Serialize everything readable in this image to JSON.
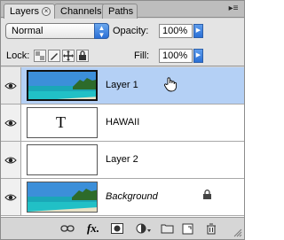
{
  "tabs": [
    {
      "label": "Layers",
      "active": true
    },
    {
      "label": "Channels",
      "active": false
    },
    {
      "label": "Paths",
      "active": false
    }
  ],
  "options": {
    "blend_mode": "Normal",
    "opacity_label": "Opacity:",
    "opacity_value": "100%",
    "lock_label": "Lock:",
    "fill_label": "Fill:",
    "fill_value": "100%"
  },
  "layers": [
    {
      "name": "Layer 1",
      "selected": true,
      "visible": true,
      "thumbnail": "beach-photo"
    },
    {
      "name": "HAWAII",
      "selected": false,
      "visible": true,
      "thumbnail": "type-layer",
      "type_glyph": "T"
    },
    {
      "name": "Layer 2",
      "selected": false,
      "visible": true,
      "thumbnail": "blank-white"
    },
    {
      "name": "Background",
      "selected": false,
      "visible": true,
      "thumbnail": "beach-photo",
      "locked": true
    }
  ],
  "bottom_icons": [
    "link-icon",
    "fx-icon",
    "mask-icon",
    "adjustment-icon",
    "group-folder-icon",
    "new-layer-icon",
    "trash-icon"
  ],
  "fx_label": "fx.",
  "colors": {
    "selection": "#b4d0f5",
    "accent_blue": "#2a6fd6",
    "panel_bg": "#d6d6d6"
  }
}
